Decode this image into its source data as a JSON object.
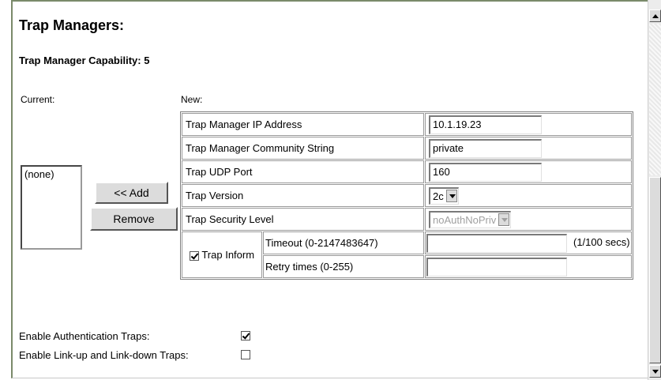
{
  "page": {
    "title": "Trap Managers:",
    "capability_label": "Trap Manager Capability: 5"
  },
  "current": {
    "label": "Current:",
    "items": [
      "(none)"
    ]
  },
  "buttons": {
    "add": "<< Add",
    "remove": "Remove"
  },
  "new": {
    "label": "New:",
    "ip_address": {
      "label": "Trap Manager IP Address",
      "value": "10.1.19.23"
    },
    "community_string": {
      "label": "Trap Manager Community String",
      "value": "private"
    },
    "udp_port": {
      "label": "Trap UDP Port",
      "value": "160"
    },
    "version": {
      "label": "Trap Version",
      "value": "2c"
    },
    "security_level": {
      "label": "Trap Security Level",
      "value": "noAuthNoPriv",
      "disabled": true
    },
    "inform": {
      "label": "Trap Inform",
      "checked": true,
      "timeout": {
        "label": "Timeout (0-2147483647)",
        "value": "",
        "unit": "(1/100 secs)"
      },
      "retry": {
        "label": "Retry times (0-255)",
        "value": ""
      }
    }
  },
  "options": {
    "auth_traps": {
      "label": "Enable Authentication Traps:",
      "checked": true
    },
    "link_traps": {
      "label": "Enable Link-up and Link-down Traps:",
      "checked": false
    }
  },
  "icons": {
    "scroll_up": "arrow-up-icon",
    "scroll_down": "arrow-down-icon",
    "dropdown": "chevron-down-icon"
  }
}
